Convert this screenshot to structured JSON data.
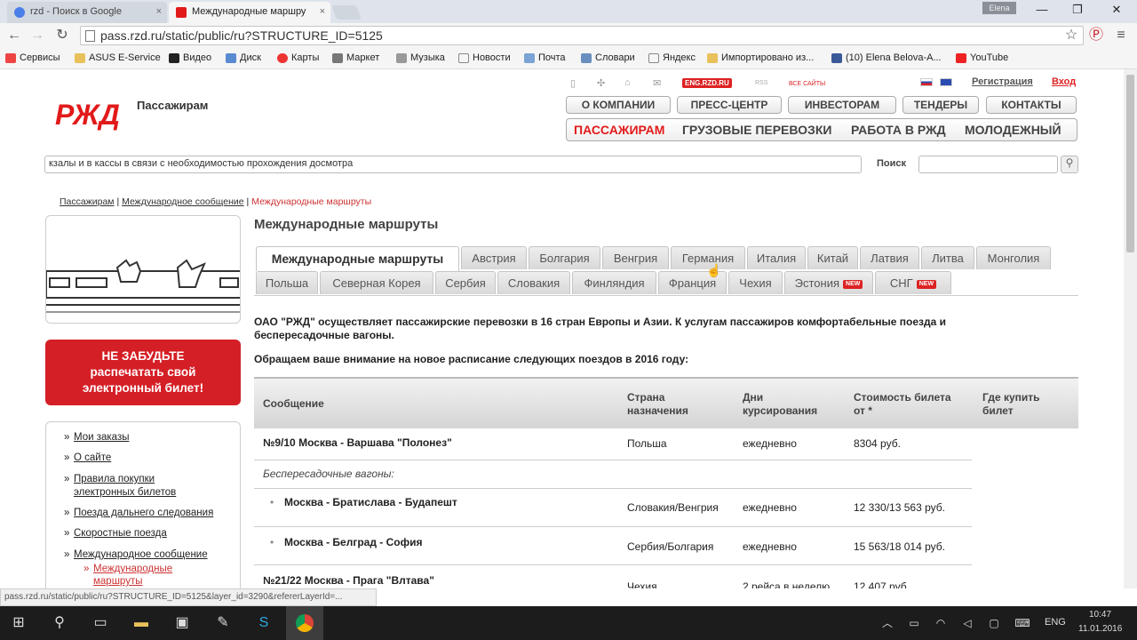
{
  "browser": {
    "tabs": [
      {
        "title": "rzd - Поиск в Google",
        "close": "×"
      },
      {
        "title": "Международные маршру",
        "close": "×"
      }
    ],
    "profile": "Elena",
    "window": {
      "min": "—",
      "max": "❐",
      "close": "✕"
    },
    "url": "pass.rzd.ru/static/public/ru?STRUCTURE_ID=5125",
    "bookmarks": [
      "Сервисы",
      "ASUS E-Service",
      "Видео",
      "Диск",
      "Карты",
      "Маркет",
      "Музыка",
      "Новости",
      "Почта",
      "Словари",
      "Яндекс",
      "Импортировано из...",
      "(10) Elena Belova-A...",
      "YouTube"
    ]
  },
  "site": {
    "logo": "РЖД",
    "section": "Пассажирам",
    "top_links": {
      "eng": "ENG.RZD.RU",
      "rss": "RSS",
      "all": "ВСЕ САЙТЫ",
      "register": "Регистрация",
      "login": "Вход"
    },
    "menu1": [
      "О КОМПАНИИ",
      "ПРЕСС-ЦЕНТР",
      "ИНВЕСТОРАМ",
      "ТЕНДЕРЫ",
      "КОНТАКТЫ"
    ],
    "menu2": [
      "ПАССАЖИРАМ",
      "ГРУЗОВЫЕ ПЕРЕВОЗКИ",
      "РАБОТА В РЖД",
      "МОЛОДЕЖНЫЙ"
    ],
    "ticker": "кзалы и в кассы в связи с необходимостью прохождения досмотра",
    "search_label": "Поиск",
    "breadcrumb": [
      "Пассажирам",
      "Международное сообщение",
      "Международные маршруты"
    ],
    "breadcrumb_sep": "|",
    "page_title": "Международные маршруты",
    "tabs_row1": [
      "Международные маршруты",
      "Австрия",
      "Болгария",
      "Венгрия",
      "Германия",
      "Италия",
      "Китай",
      "Латвия",
      "Литва",
      "Монголия"
    ],
    "tabs_row2": [
      "Польша",
      "Северная Корея",
      "Сербия",
      "Словакия",
      "Финляндия",
      "Франция",
      "Чехия",
      "Эстония",
      "СНГ"
    ],
    "new_badge": "NEW",
    "intro": "ОАО \"РЖД\" осуществляет пассажирские перевозки в 16 стран Европы и Азии. К услугам пассажиров комфортабельные поезда и беспересадочные вагоны.",
    "notice": "Обращаем ваше внимание на новое расписание следующих поездов в 2016 году:",
    "table": {
      "headers": [
        "Сообщение",
        "Страна назначения",
        "Дни курсирования",
        "Стоимость билета от *",
        "Где купить билет"
      ],
      "rows": [
        {
          "route": "№9/10 Москва - Варшава \"Полонез\"",
          "country": "Польша",
          "days": "ежедневно",
          "price": "8304 руб."
        },
        {
          "route": "Беспересадочные вагоны:"
        },
        {
          "route": "Москва - Братислава - Будапешт",
          "country": "Словакия/Венгрия",
          "days": "ежедневно",
          "price": "12 330/13 563 руб."
        },
        {
          "route": "Москва - Белград - София",
          "country": "Сербия/Болгария",
          "days": "ежедневно",
          "price": "15 563/18 014 руб."
        },
        {
          "route": "№21/22 Москва - Прага \"Влтава\"",
          "country": "Чехия",
          "days": "2 рейса в неделю",
          "price": "12 407 руб."
        }
      ]
    },
    "promo": "НЕ ЗАБУДЬТЕ распечатать свой электронный билет!",
    "sidebar": [
      "Мои заказы",
      "О сайте",
      "Правила покупки электронных билетов",
      "Поезда дальнего следования",
      "Скоростные поезда",
      "Международное сообщение",
      "Международные маршруты"
    ]
  },
  "status_url": "pass.rzd.ru/static/public/ru?STRUCTURE_ID=5125&layer_id=3290&refererLayerId=...",
  "taskbar": {
    "lang": "ENG",
    "time": "10:47",
    "date": "11.01.2016"
  },
  "colors": {
    "brand": "#e21a1a",
    "link": "#222"
  }
}
